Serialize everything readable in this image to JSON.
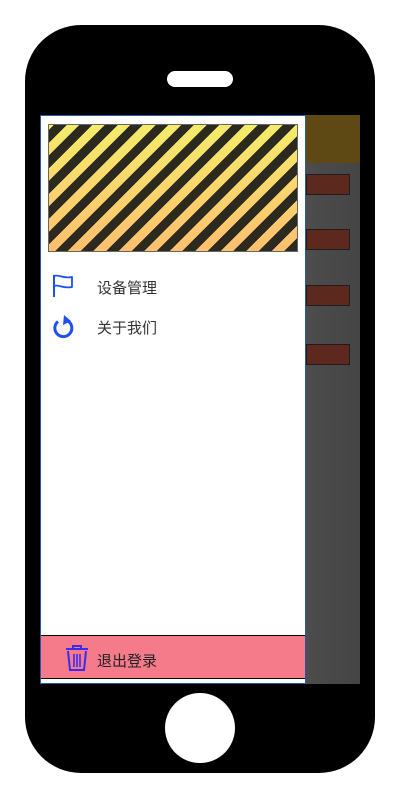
{
  "drawer": {
    "menu": [
      {
        "label": "设备管理",
        "icon": "flag-icon"
      },
      {
        "label": "关于我们",
        "icon": "refresh-icon"
      }
    ],
    "logout": {
      "label": "退出登录",
      "icon": "trash-icon"
    }
  },
  "colors": {
    "icon_blue": "#1e4ff0",
    "logout_bg": "#f57a8a",
    "logout_icon": "#3b2cf5"
  }
}
